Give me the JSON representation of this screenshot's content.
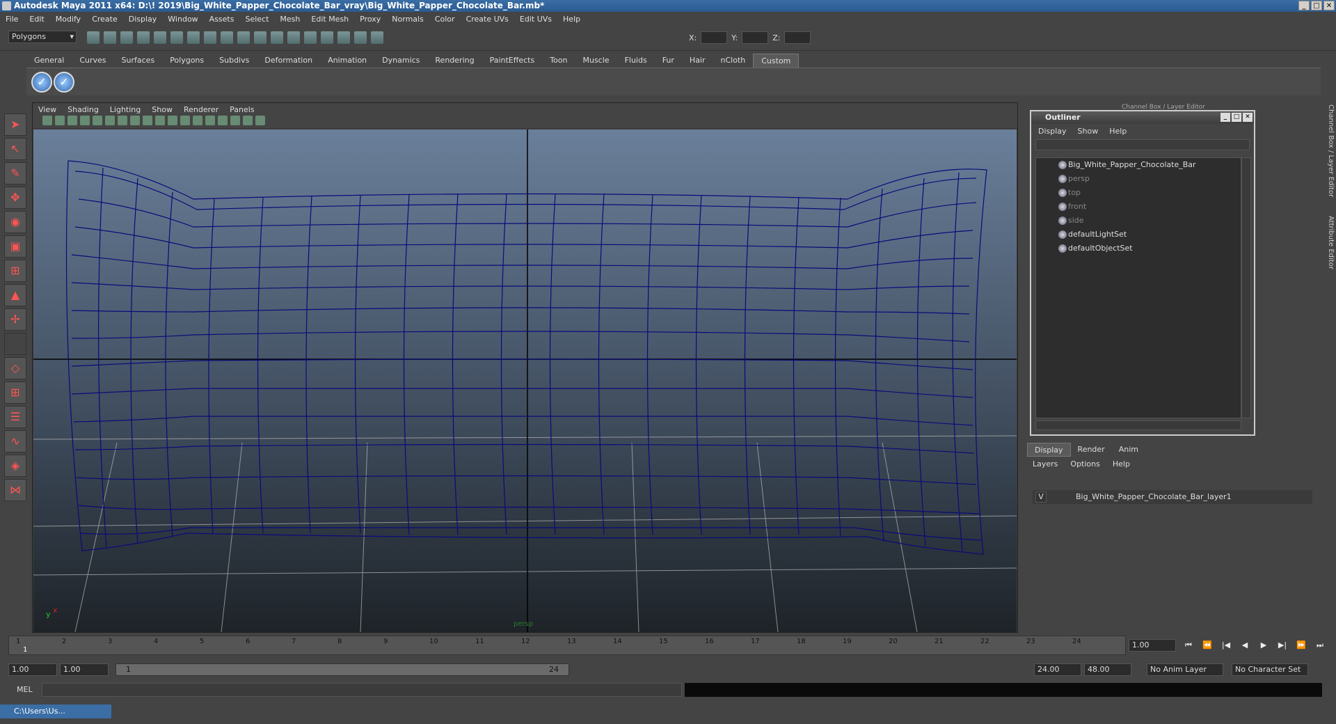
{
  "window": {
    "title": "Autodesk Maya 2011 x64: D:\\! 2019\\Big_White_Papper_Chocolate_Bar_vray\\Big_White_Papper_Chocolate_Bar.mb*"
  },
  "menu": [
    "File",
    "Edit",
    "Modify",
    "Create",
    "Display",
    "Window",
    "Assets",
    "Select",
    "Mesh",
    "Edit Mesh",
    "Proxy",
    "Normals",
    "Color",
    "Create UVs",
    "Edit UVs",
    "Help"
  ],
  "mode_selector": "Polygons",
  "coords": {
    "x": "X:",
    "y": "Y:",
    "z": "Z:"
  },
  "shelf_tabs": [
    "General",
    "Curves",
    "Surfaces",
    "Polygons",
    "Subdivs",
    "Deformation",
    "Animation",
    "Dynamics",
    "Rendering",
    "PaintEffects",
    "Toon",
    "Muscle",
    "Fluids",
    "Fur",
    "Hair",
    "nCloth",
    "Custom"
  ],
  "active_shelf": "Custom",
  "viewport": {
    "menu": [
      "View",
      "Shading",
      "Lighting",
      "Show",
      "Renderer",
      "Panels"
    ],
    "camera_label": "persp",
    "axis_y": "y",
    "axis_x": "x"
  },
  "outliner": {
    "title": "Outliner",
    "menu": [
      "Display",
      "Show",
      "Help"
    ],
    "items": [
      {
        "label": "Big_White_Papper_Chocolate_Bar",
        "dim": false
      },
      {
        "label": "persp",
        "dim": true
      },
      {
        "label": "top",
        "dim": true
      },
      {
        "label": "front",
        "dim": true
      },
      {
        "label": "side",
        "dim": true
      },
      {
        "label": "defaultLightSet",
        "dim": false
      },
      {
        "label": "defaultObjectSet",
        "dim": false
      }
    ]
  },
  "channel_box_title": "Channel Box / Layer Editor",
  "side_tabs": {
    "channel": "Channel Box / Layer Editor",
    "attr": "Attribute Editor"
  },
  "layers": {
    "tabs": [
      "Display",
      "Render",
      "Anim"
    ],
    "menu": [
      "Layers",
      "Options",
      "Help"
    ],
    "row": {
      "vis": "V",
      "name": "Big_White_Papper_Chocolate_Bar_layer1"
    }
  },
  "timeline": {
    "ticks": [
      "1",
      "2",
      "3",
      "4",
      "5",
      "6",
      "7",
      "8",
      "9",
      "10",
      "11",
      "12",
      "13",
      "14",
      "15",
      "16",
      "17",
      "18",
      "19",
      "20",
      "21",
      "22",
      "23",
      "24"
    ],
    "current_frame": "1.00",
    "start_marker": "1"
  },
  "range": {
    "start": "1.00",
    "start2": "1.00",
    "slider_start": "1",
    "slider_end": "24",
    "end": "24.00",
    "end2": "48.00",
    "anim_layer": "No Anim Layer",
    "char_set": "No Character Set"
  },
  "mel": {
    "label": "MEL"
  },
  "taskbar": {
    "label": "C:\\Users\\Us..."
  }
}
